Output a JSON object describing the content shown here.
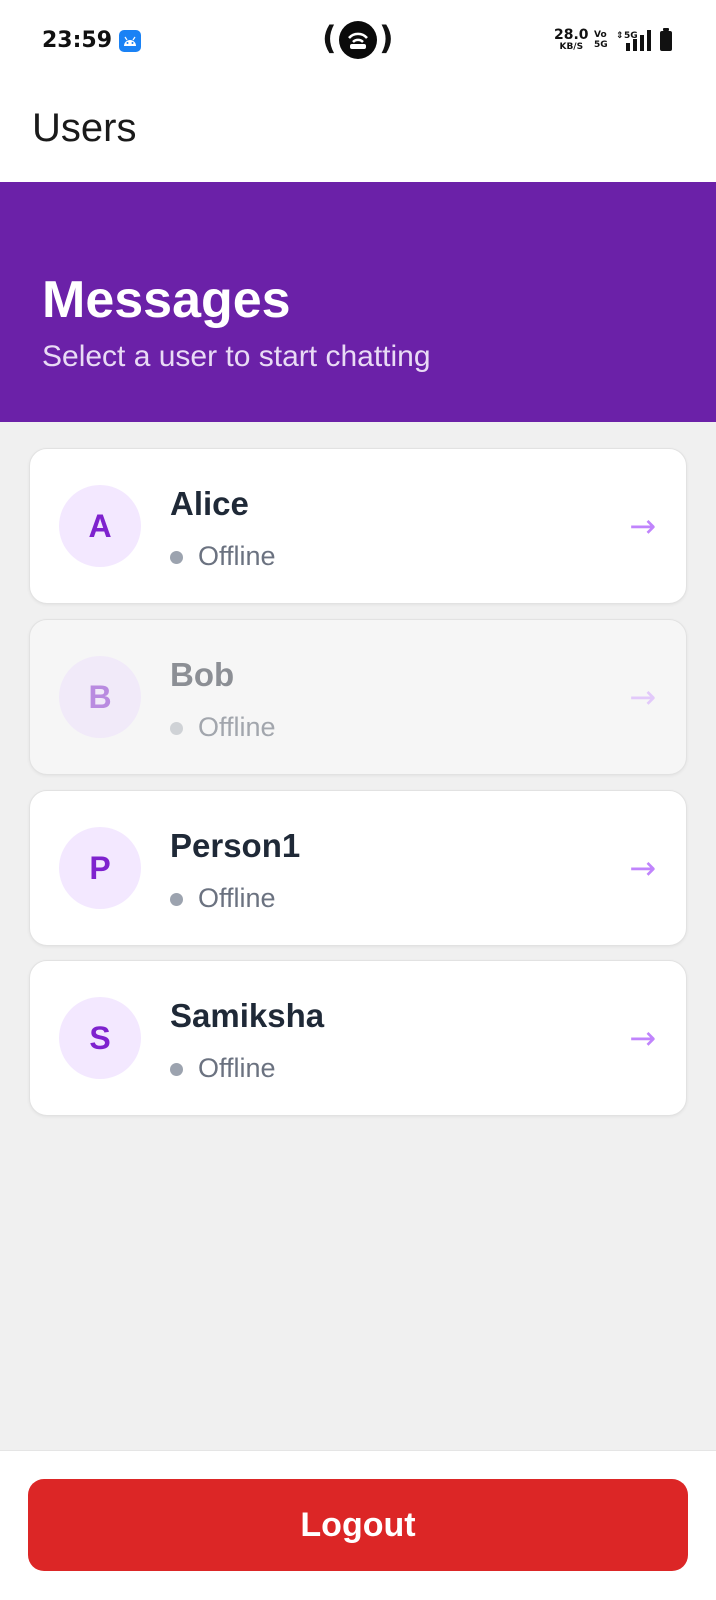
{
  "status_bar": {
    "time": "23:59",
    "net_speed_value": "28.0",
    "net_speed_unit": "KB/S",
    "volte_top": "Vo",
    "volte_bottom": "5G",
    "network_type": "5G",
    "icons": [
      "android-notification-icon",
      "hotspot-icon",
      "signal-icon",
      "battery-icon"
    ]
  },
  "app_bar": {
    "title": "Users"
  },
  "header": {
    "title": "Messages",
    "subtitle": "Select a user to start chatting",
    "background_color": "#6b21a8"
  },
  "users": [
    {
      "initial": "A",
      "name": "Alice",
      "status": "Offline",
      "arrow": "→"
    },
    {
      "initial": "B",
      "name": "Bob",
      "status": "Offline",
      "arrow": "→"
    },
    {
      "initial": "P",
      "name": "Person1",
      "status": "Offline",
      "arrow": "→"
    },
    {
      "initial": "S",
      "name": "Samiksha",
      "status": "Offline",
      "arrow": "→"
    }
  ],
  "footer": {
    "logout_label": "Logout",
    "logout_color": "#dc2626"
  }
}
